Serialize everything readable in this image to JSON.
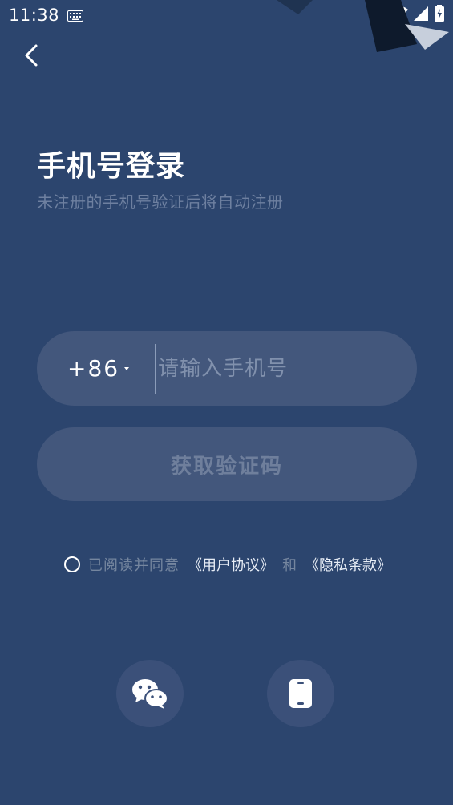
{
  "status_bar": {
    "time": "11:38",
    "icons": [
      "keyboard-icon",
      "wifi-icon",
      "signal-icon",
      "battery-charging-icon"
    ]
  },
  "header": {
    "back_icon": "chevron-left-icon"
  },
  "login": {
    "title": "手机号登录",
    "subtitle": "未注册的手机号验证后将自动注册",
    "country_code": "+86",
    "phone_placeholder": "请输入手机号",
    "phone_value": "",
    "get_code_label": "获取验证码"
  },
  "agreement": {
    "checked": false,
    "text": "已阅读并同意",
    "user_agreement": "《用户协议》",
    "and": "和",
    "privacy_policy": "《隐私条款》"
  },
  "alt_login": {
    "wechat_icon": "wechat-icon",
    "phone_icon": "mobile-phone-icon"
  },
  "colors": {
    "background": "#2c456e",
    "field": "#43577c",
    "muted_text": "#75869f"
  }
}
